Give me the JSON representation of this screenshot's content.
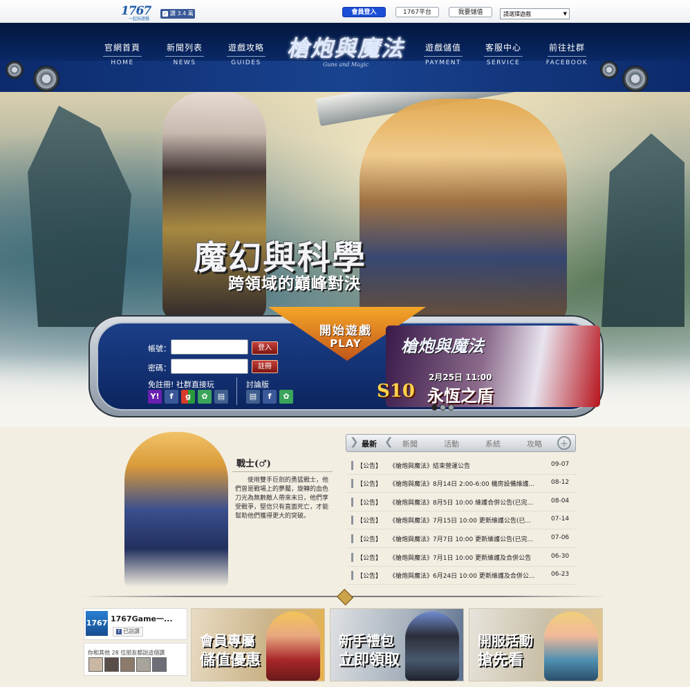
{
  "topbar": {
    "logo": "1767",
    "logo_sub": "一起玩遊戲",
    "like_label": "讚 3.4 萬",
    "member_login": "會員登入",
    "platform": "1767平台",
    "topup": "我要儲值",
    "game_select": "請選擇遊戲"
  },
  "nav": [
    {
      "zh": "官網首頁",
      "en": "HOME"
    },
    {
      "zh": "新聞列表",
      "en": "NEWS"
    },
    {
      "zh": "遊戲攻略",
      "en": "GUIDES"
    },
    {
      "zh": "遊戲儲值",
      "en": "PAYMENT"
    },
    {
      "zh": "客服中心",
      "en": "SERVICE"
    },
    {
      "zh": "前往社群",
      "en": "FACEBOOK"
    }
  ],
  "site_logo": {
    "title": "槍炮與魔法",
    "subtitle": "Guns and Magic"
  },
  "hero": {
    "slogan_main": "魔幻與科學",
    "slogan_sub": "跨領域的巔峰對決"
  },
  "login": {
    "account_label": "帳號：",
    "password_label": "密碼：",
    "login_button": "登入",
    "register_button": "註冊",
    "social_label": "免註冊! 社群直接玩",
    "forum_label": "討論版",
    "play_zh": "開始遊戲",
    "play_en": "PLAY"
  },
  "promo": {
    "logo": "槍炮與魔法",
    "date": "2月25日 11:00",
    "season": "S10",
    "title": "永恆之盾"
  },
  "class_intro": {
    "title": "戰士(♂)",
    "description": "使用雙手巨劍的勇猛戰士，他們曾是戰場上的夢魘，旋轉的血色刀光為無數敵人帶來末日，他們享受戰爭，堅信只有直面死亡，才能幫助他們獲得更大的突破。"
  },
  "news": {
    "tabs": [
      "最新",
      "新聞",
      "活動",
      "系統",
      "攻略"
    ],
    "items": [
      {
        "tag": "【公告】",
        "title": "《槍炮與魔法》結束營運公告",
        "date": "09-07"
      },
      {
        "tag": "【公告】",
        "title": "《槍炮與魔法》8月14日 2:00-6:00 機房設備維護...",
        "date": "08-12"
      },
      {
        "tag": "【公告】",
        "title": "《槍炮與魔法》8月5日 10:00 維護合併公告(已完...",
        "date": "08-04"
      },
      {
        "tag": "【公告】",
        "title": "《槍炮與魔法》7月15日 10:00 更新維護公告(已...",
        "date": "07-14"
      },
      {
        "tag": "【公告】",
        "title": "《槍炮與魔法》7月7日 10:00 更新維護公告(已完...",
        "date": "07-06"
      },
      {
        "tag": "【公告】",
        "title": "《槍炮與魔法》7月1日 10:00 更新維護及合併公告",
        "date": "06-30"
      },
      {
        "tag": "【公告】",
        "title": "《槍炮與魔法》6月24日 10:00 更新維護及合併公...",
        "date": "06-23"
      }
    ]
  },
  "facebook": {
    "logo": "1767",
    "name": "1767Game一...",
    "liked": "已說讚",
    "friends": "你和其他 28 位朋友都說這個讚"
  },
  "banners": [
    {
      "line1": "會員專屬",
      "line2": "儲值優惠"
    },
    {
      "line1": "新手禮包",
      "line2": "立即領取"
    },
    {
      "line1": "開服活動",
      "line2": "搶先看"
    }
  ],
  "colors": {
    "header_blue": "#0a2a6a",
    "accent_orange": "#f4a628",
    "login_blue": "#1b4fd6",
    "red_button": "#c6403b"
  }
}
